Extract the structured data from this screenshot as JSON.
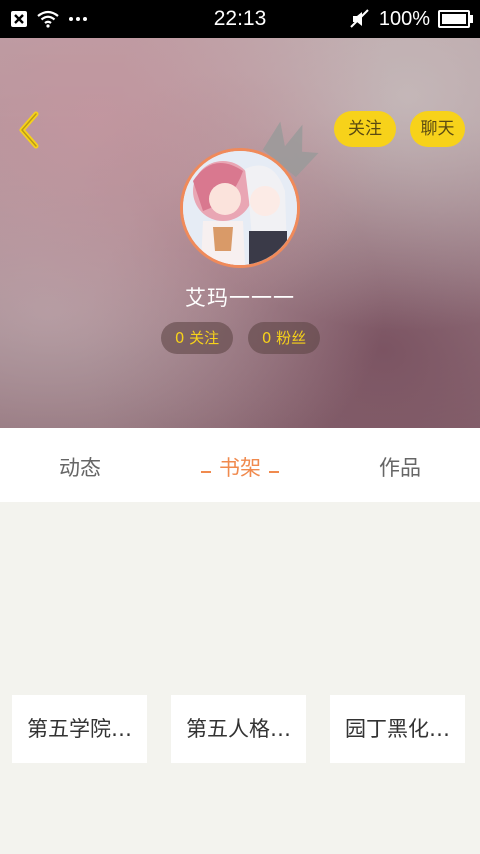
{
  "status_bar": {
    "time": "22:13",
    "battery": "100%",
    "icons": [
      "close-box-icon",
      "wifi-icon",
      "more-dots-icon",
      "mute-icon",
      "battery-icon"
    ]
  },
  "header": {
    "back_icon": "chevron-left-icon",
    "follow_button": "关注",
    "chat_button": "聊天"
  },
  "profile": {
    "username": "艾玛一一一",
    "following": "0 关注",
    "fans": "0 粉丝"
  },
  "tabs": [
    {
      "label": "动态",
      "active": false
    },
    {
      "label": "书架",
      "active": true
    },
    {
      "label": "作品",
      "active": false
    }
  ],
  "bookshelf": [
    {
      "title": "第五学院…"
    },
    {
      "title": "第五人格…"
    },
    {
      "title": "园丁黑化…"
    }
  ],
  "colors": {
    "accent_yellow": "#f7d21a",
    "active_tab": "#f08a4e",
    "background": "#f3f3ee"
  }
}
